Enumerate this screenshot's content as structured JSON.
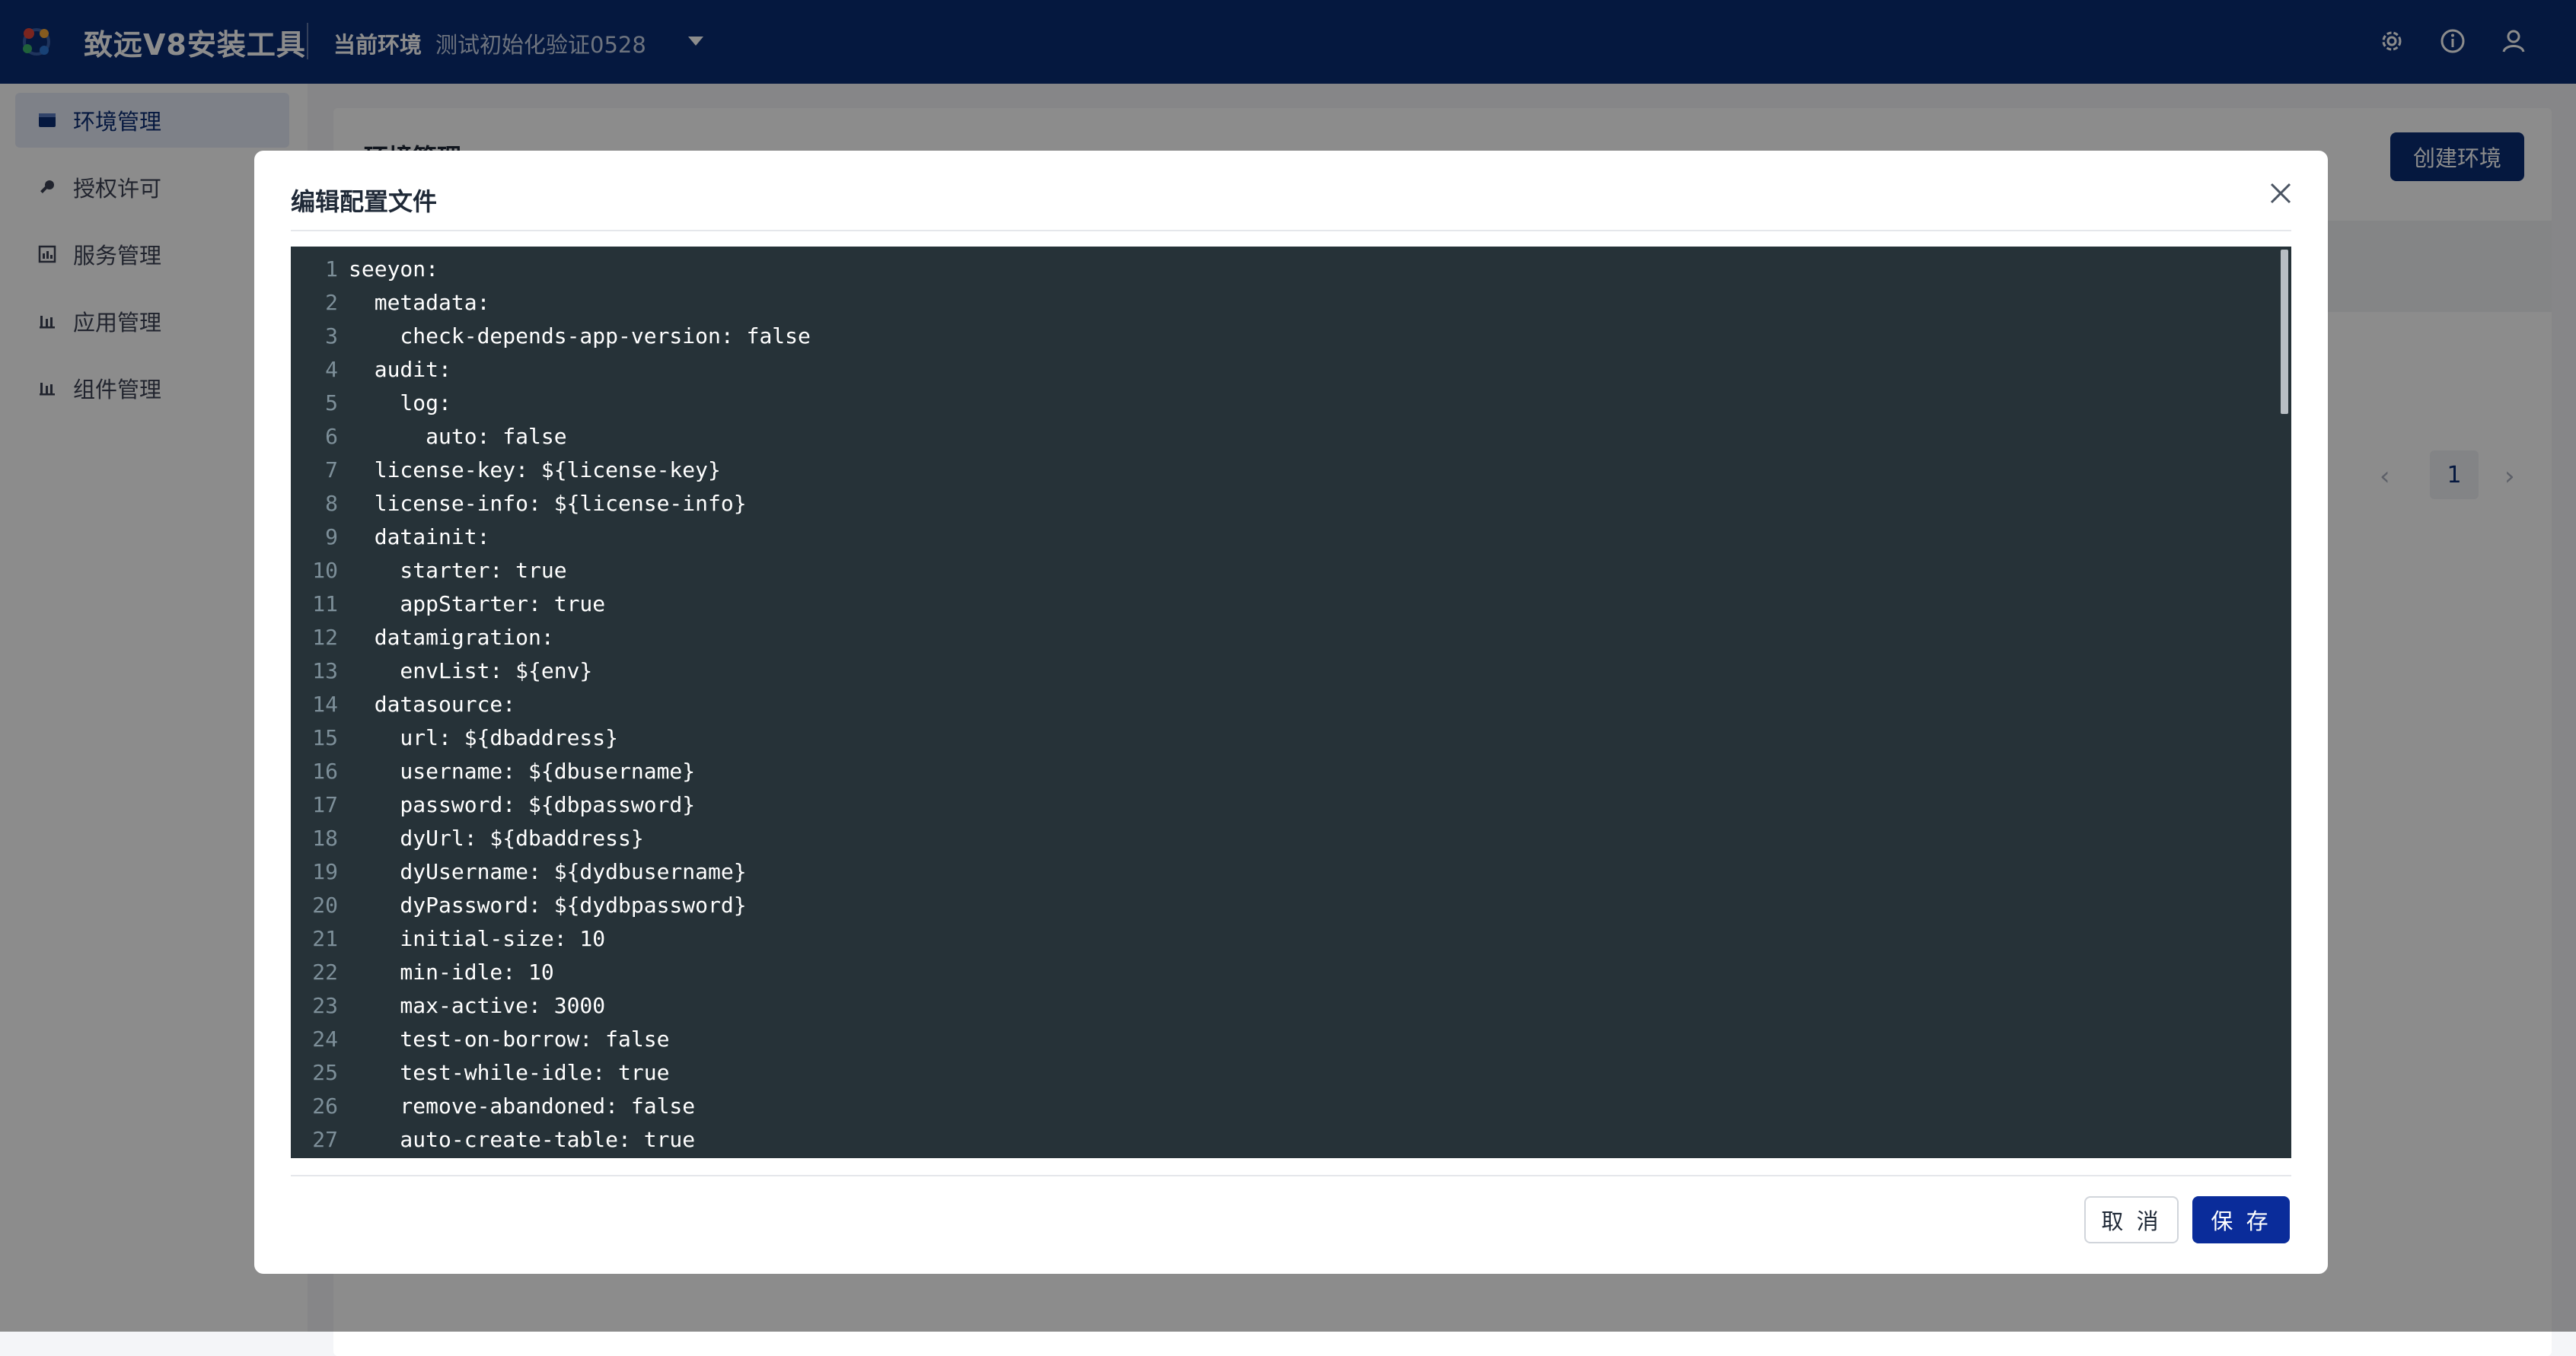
{
  "app": {
    "title": "致远V8安装工具"
  },
  "header": {
    "env_label": "当前环境",
    "env_value": "测试初始化验证0528",
    "icons": [
      "gear-icon",
      "info-icon",
      "user-icon"
    ]
  },
  "sidebar": {
    "items": [
      {
        "label": "环境管理",
        "icon": "environment-icon",
        "active": true
      },
      {
        "label": "授权许可",
        "icon": "key-icon",
        "active": false
      },
      {
        "label": "服务管理",
        "icon": "service-icon",
        "active": false
      },
      {
        "label": "应用管理",
        "icon": "app-icon",
        "active": false
      },
      {
        "label": "组件管理",
        "icon": "component-icon",
        "active": false
      }
    ]
  },
  "main": {
    "title": "环境管理",
    "create_button": "创建环境",
    "pagination": {
      "prev": "‹",
      "current": "1",
      "next": "›"
    }
  },
  "modal": {
    "title": "编辑配置文件",
    "cancel_label": "取 消",
    "save_label": "保 存",
    "lines": [
      "seeyon:",
      "  metadata:",
      "    check-depends-app-version: false",
      "  audit:",
      "    log:",
      "      auto: false",
      "  license-key: ${license-key}",
      "  license-info: ${license-info}",
      "  datainit:",
      "    starter: true",
      "    appStarter: true",
      "  datamigration:",
      "    envList: ${env}",
      "  datasource:",
      "    url: ${dbaddress}",
      "    username: ${dbusername}",
      "    password: ${dbpassword}",
      "    dyUrl: ${dbaddress}",
      "    dyUsername: ${dydbusername}",
      "    dyPassword: ${dydbpassword}",
      "    initial-size: 10",
      "    min-idle: 10",
      "    max-active: 3000",
      "    test-on-borrow: false",
      "    test-while-idle: true",
      "    remove-abandoned: false",
      "    auto-create-table: true"
    ]
  },
  "colors": {
    "header_bg": "#0a2c74",
    "primary": "#0a2c9a",
    "editor_bg": "#263238"
  }
}
